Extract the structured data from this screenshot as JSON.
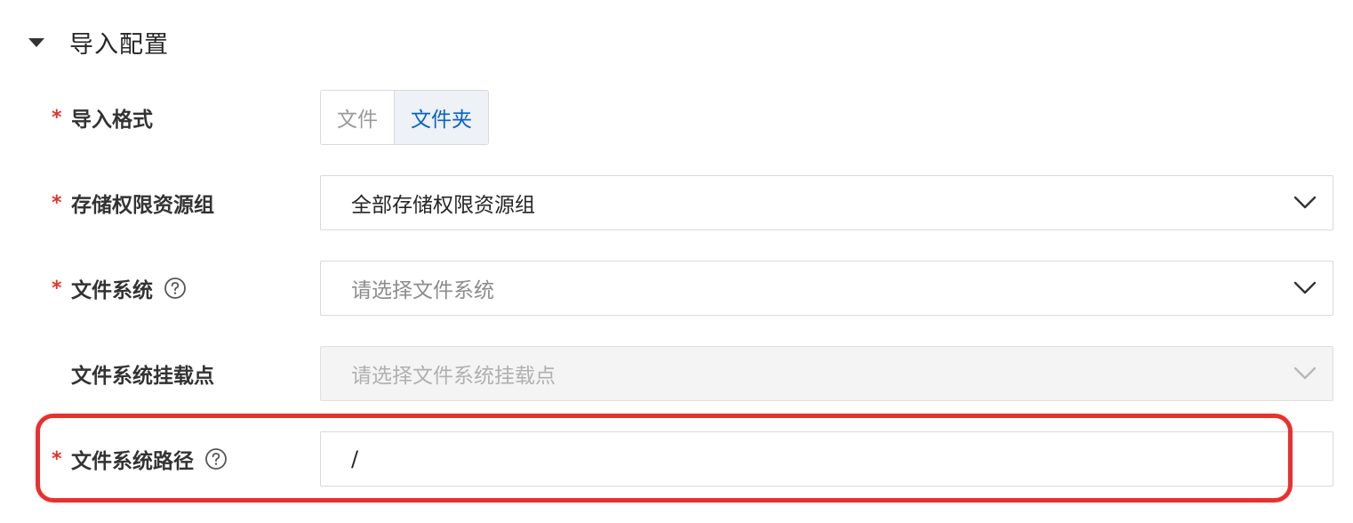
{
  "section": {
    "title": "导入配置",
    "expanded": true,
    "caret_icon": "caret-down-icon"
  },
  "form": {
    "required_mark": "*",
    "import_format": {
      "label": "导入格式",
      "required": true,
      "options": [
        "文件",
        "文件夹"
      ],
      "selected": "文件夹"
    },
    "storage_group": {
      "label": "存储权限资源组",
      "required": true,
      "value": "全部存储权限资源组"
    },
    "file_system": {
      "label": "文件系统",
      "required": true,
      "has_help": true,
      "placeholder": "请选择文件系统"
    },
    "mount_point": {
      "label": "文件系统挂载点",
      "required": false,
      "placeholder": "请选择文件系统挂载点",
      "disabled": true
    },
    "file_system_path": {
      "label": "文件系统路径",
      "required": true,
      "has_help": true,
      "value": "/"
    }
  },
  "colors": {
    "required_star": "#e0352b",
    "segment_active_text": "#0a62c6",
    "highlight_border": "#e8312f"
  }
}
